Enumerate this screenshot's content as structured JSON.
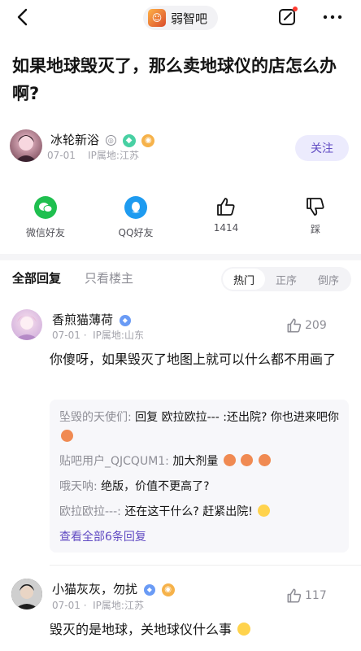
{
  "header": {
    "forum_name": "弱智吧",
    "icons": [
      "back-icon",
      "edit-icon",
      "more-icon"
    ]
  },
  "post": {
    "title": "如果地球毁灭了，那么卖地球仪的店怎么办啊?",
    "author": {
      "name": "冰轮新浴",
      "date": "07-01",
      "ip": "IP属地:江苏"
    },
    "follow_label": "关注"
  },
  "share": [
    {
      "label": "微信好友",
      "icon": "wechat-icon"
    },
    {
      "label": "QQ好友",
      "icon": "qq-icon"
    },
    {
      "label": "1414",
      "icon": "thumb-up-icon"
    },
    {
      "label": "踩",
      "icon": "thumb-down-icon"
    }
  ],
  "replies_tabs": {
    "all": "全部回复",
    "op_only": "只看楼主",
    "sort": [
      "热门",
      "正序",
      "倒序"
    ],
    "active_sort": "热门"
  },
  "comments": [
    {
      "name": "香煎猫薄荷",
      "date": "07-01",
      "ip": "IP属地:山东",
      "likes": "209",
      "text": "你傻呀，如果毁灭了地图上就可以什么都不用画了",
      "subreplies": [
        {
          "name": "坠毁的天使们:",
          "text": "回复 欧拉欧拉--- :还出院? 你也进来吧你"
        },
        {
          "name": "贴吧用户_QJCQUM1:",
          "text": "加大剂量"
        },
        {
          "name": "哦天呐:",
          "text": "绝版，价值不更高了?"
        },
        {
          "name": "欧拉欧拉---:",
          "text": "还在这干什么? 赶紧出院!"
        }
      ],
      "view_all": "查看全部6条回复"
    },
    {
      "name": "小猫灰灰，勿扰",
      "date": "07-01",
      "ip": "IP属地:江苏",
      "likes": "117",
      "text": "毁灭的是地球，关地球仪什么事"
    }
  ],
  "colors": {
    "accent": "#614bc3",
    "follow_bg": "#ecebfd",
    "wechat": "#1fbf4f",
    "qq": "#1e9bf0"
  }
}
